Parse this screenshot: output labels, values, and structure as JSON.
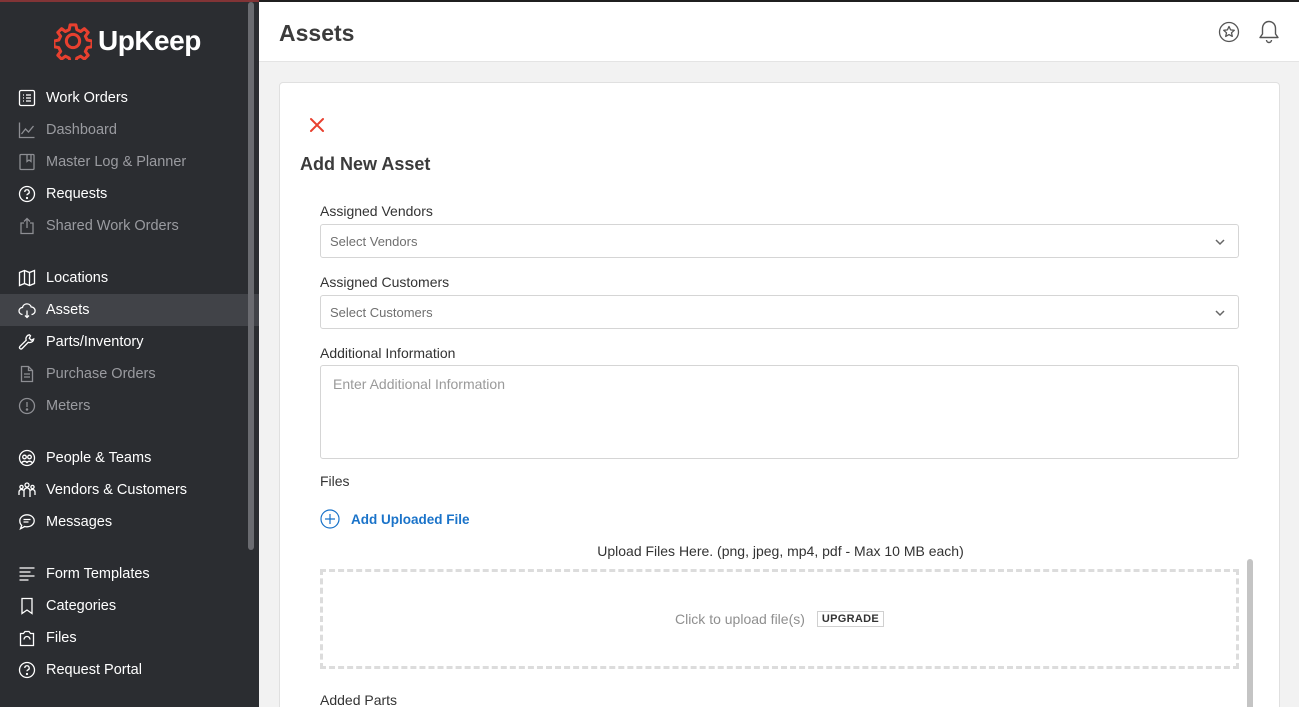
{
  "brand": {
    "name": "UpKeep",
    "accent": "#e8402f"
  },
  "sidebar": {
    "groups": [
      [
        {
          "label": "Work Orders",
          "icon": "list-icon",
          "disabled": false
        },
        {
          "label": "Dashboard",
          "icon": "chart-line-icon",
          "disabled": true
        },
        {
          "label": "Master Log & Planner",
          "icon": "planner-icon",
          "disabled": true
        },
        {
          "label": "Requests",
          "icon": "question-circle-icon",
          "disabled": false
        },
        {
          "label": "Shared Work Orders",
          "icon": "share-icon",
          "disabled": true
        }
      ],
      [
        {
          "label": "Locations",
          "icon": "map-icon",
          "disabled": false
        },
        {
          "label": "Assets",
          "icon": "cloud-asset-icon",
          "disabled": false,
          "active": true
        },
        {
          "label": "Parts/Inventory",
          "icon": "wrench-icon",
          "disabled": false
        },
        {
          "label": "Purchase Orders",
          "icon": "document-icon",
          "disabled": true
        },
        {
          "label": "Meters",
          "icon": "meter-icon",
          "disabled": true
        }
      ],
      [
        {
          "label": "People & Teams",
          "icon": "people-icon",
          "disabled": false
        },
        {
          "label": "Vendors & Customers",
          "icon": "vendors-icon",
          "disabled": false
        },
        {
          "label": "Messages",
          "icon": "chat-icon",
          "disabled": false
        }
      ],
      [
        {
          "label": "Form Templates",
          "icon": "form-icon",
          "disabled": false
        },
        {
          "label": "Categories",
          "icon": "bookmark-icon",
          "disabled": false
        },
        {
          "label": "Files",
          "icon": "files-icon",
          "disabled": false
        },
        {
          "label": "Request Portal",
          "icon": "question-circle-icon",
          "disabled": false
        }
      ]
    ]
  },
  "header": {
    "title": "Assets"
  },
  "form": {
    "title": "Add New Asset",
    "vendors": {
      "label": "Assigned Vendors",
      "placeholder": "Select Vendors"
    },
    "customers": {
      "label": "Assigned Customers",
      "placeholder": "Select Customers"
    },
    "additional": {
      "label": "Additional Information",
      "placeholder": "Enter Additional Information"
    },
    "files": {
      "label": "Files",
      "add_label": "Add Uploaded File",
      "hint": "Upload Files Here. (png, jpeg, mp4, pdf - Max 10 MB each)",
      "dropzone_text": "Click to upload file(s)",
      "upgrade_badge": "UPGRADE"
    },
    "parts": {
      "label": "Added Parts"
    }
  }
}
